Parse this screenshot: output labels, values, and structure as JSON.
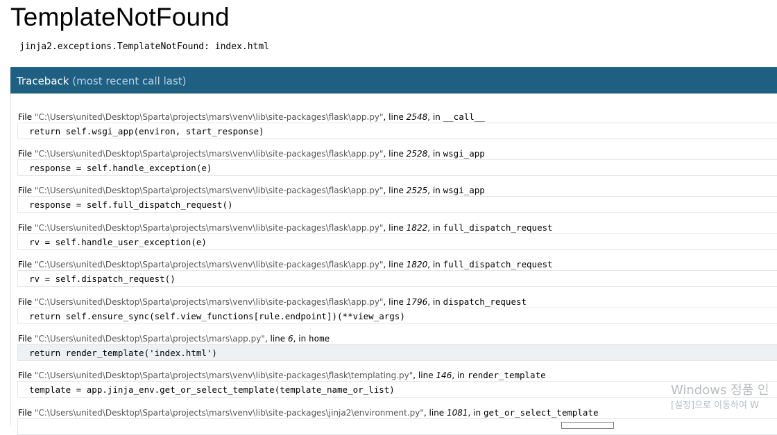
{
  "page": {
    "title": "TemplateNotFound",
    "error_message": "jinja2.exceptions.TemplateNotFound: index.html"
  },
  "traceback": {
    "header": "Traceback",
    "header_sub": "(most recent call last)",
    "file_prefix": "File",
    "line_label": ", line",
    "in_label": ", in",
    "frames": [
      {
        "path": "\"C:\\Users\\united\\Desktop\\Sparta\\projects\\mars\\venv\\lib\\site-packages\\flask\\app.py\"",
        "line": "2548",
        "func": "__call__",
        "code": "return self.wsgi_app(environ, start_response)"
      },
      {
        "path": "\"C:\\Users\\united\\Desktop\\Sparta\\projects\\mars\\venv\\lib\\site-packages\\flask\\app.py\"",
        "line": "2528",
        "func": "wsgi_app",
        "code": "response = self.handle_exception(e)"
      },
      {
        "path": "\"C:\\Users\\united\\Desktop\\Sparta\\projects\\mars\\venv\\lib\\site-packages\\flask\\app.py\"",
        "line": "2525",
        "func": "wsgi_app",
        "code": "response = self.full_dispatch_request()"
      },
      {
        "path": "\"C:\\Users\\united\\Desktop\\Sparta\\projects\\mars\\venv\\lib\\site-packages\\flask\\app.py\"",
        "line": "1822",
        "func": "full_dispatch_request",
        "code": "rv = self.handle_user_exception(e)"
      },
      {
        "path": "\"C:\\Users\\united\\Desktop\\Sparta\\projects\\mars\\venv\\lib\\site-packages\\flask\\app.py\"",
        "line": "1820",
        "func": "full_dispatch_request",
        "code": "rv = self.dispatch_request()"
      },
      {
        "path": "\"C:\\Users\\united\\Desktop\\Sparta\\projects\\mars\\venv\\lib\\site-packages\\flask\\app.py\"",
        "line": "1796",
        "func": "dispatch_request",
        "code": "return self.ensure_sync(self.view_functions[rule.endpoint])(**view_args)"
      },
      {
        "path": "\"C:\\Users\\united\\Desktop\\Sparta\\projects\\mars\\app.py\"",
        "line": "6",
        "func": "home",
        "code": "return render_template('index.html')"
      },
      {
        "path": "\"C:\\Users\\united\\Desktop\\Sparta\\projects\\mars\\venv\\lib\\site-packages\\flask\\templating.py\"",
        "line": "146",
        "func": "render_template",
        "code": "template = app.jinja_env.get_or_select_template(template_name_or_list)"
      },
      {
        "path": "\"C:\\Users\\united\\Desktop\\Sparta\\projects\\mars\\venv\\lib\\site-packages\\jinja2\\environment.py\"",
        "line": "1081",
        "func": "get_or_select_template",
        "code": ""
      }
    ]
  },
  "watermark": {
    "line1": "Windows 정품 인",
    "line2": "[설정]으로 이동하여 W"
  },
  "colors": {
    "header_bg": "#1f5f82",
    "header_sub": "#b7d5e6",
    "current_frame_bg": "#eef1f3"
  }
}
